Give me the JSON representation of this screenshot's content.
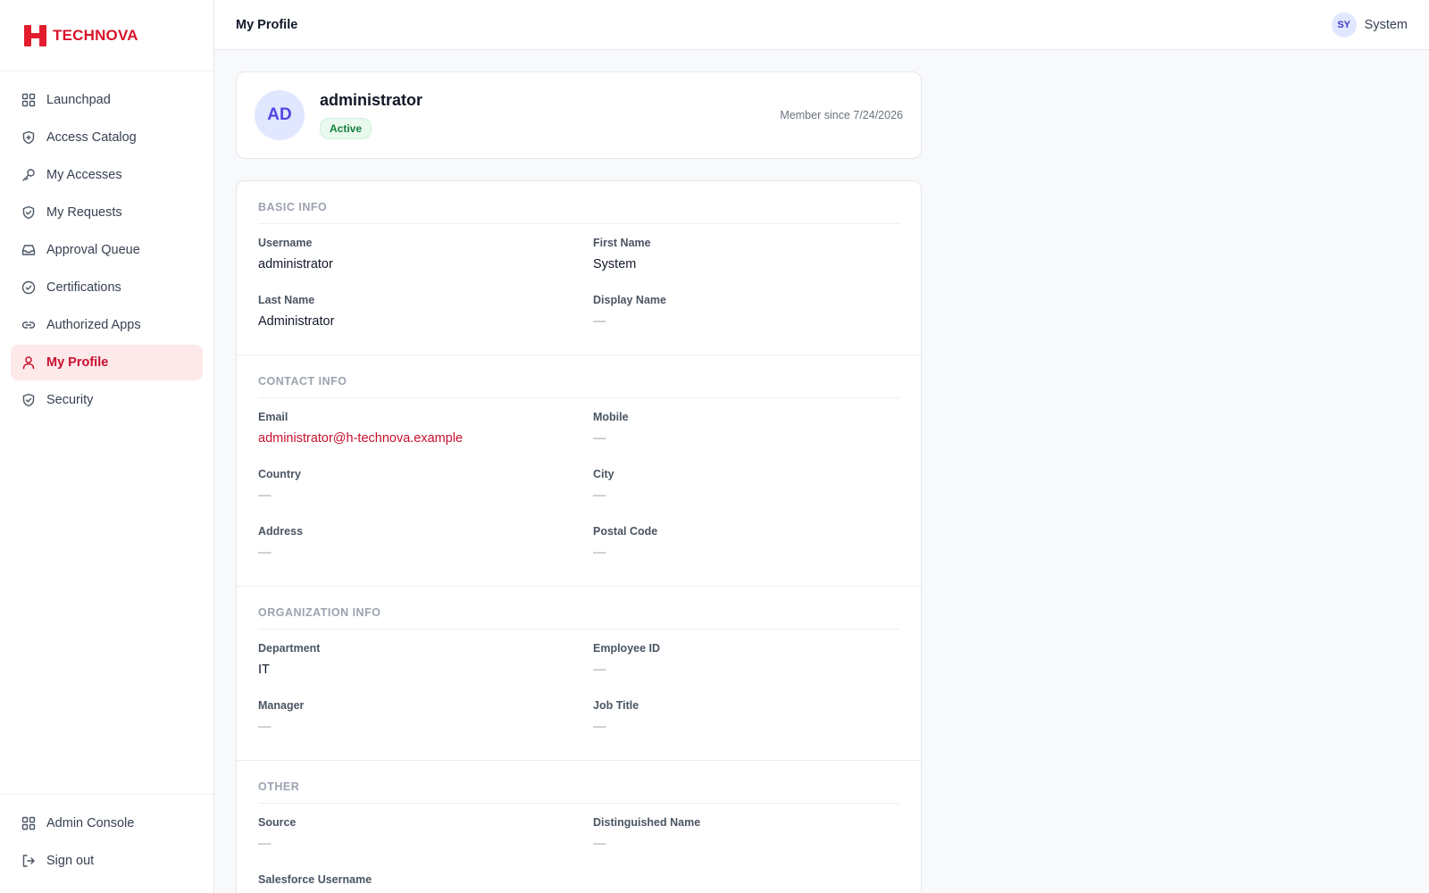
{
  "brand": {
    "name": "TECHNOVA",
    "accent": "#d9142b"
  },
  "sidebar": {
    "items": [
      {
        "label": "Launchpad",
        "icon": "grid-icon"
      },
      {
        "label": "Access Catalog",
        "icon": "shield-plus-icon"
      },
      {
        "label": "My Accesses",
        "icon": "key-icon"
      },
      {
        "label": "My Requests",
        "icon": "shield-check-icon"
      },
      {
        "label": "Approval Queue",
        "icon": "inbox-icon"
      },
      {
        "label": "Certifications",
        "icon": "check-circle-icon"
      },
      {
        "label": "Authorized Apps",
        "icon": "link-icon"
      },
      {
        "label": "My Profile",
        "icon": "user-icon",
        "active": true
      },
      {
        "label": "Security",
        "icon": "shield-icon"
      }
    ],
    "bottom": [
      {
        "label": "Admin Console",
        "icon": "grid-icon"
      },
      {
        "label": "Sign out",
        "icon": "sign-out-icon"
      }
    ]
  },
  "header": {
    "title": "My Profile",
    "user_initials": "SY",
    "user_name": "System"
  },
  "profile": {
    "initials": "AD",
    "name": "administrator",
    "status": "Active",
    "member_since": "Member since 7/24/2026"
  },
  "sections": {
    "basic": {
      "title": "BASIC INFO",
      "fields": [
        {
          "label": "Username",
          "value": "administrator"
        },
        {
          "label": "First Name",
          "value": "System"
        },
        {
          "label": "Last Name",
          "value": "Administrator"
        },
        {
          "label": "Display Name",
          "value": "—"
        }
      ]
    },
    "contact": {
      "title": "CONTACT INFO",
      "fields": [
        {
          "label": "Email",
          "value": "administrator@h-technova.example"
        },
        {
          "label": "Mobile",
          "value": "—"
        },
        {
          "label": "Country",
          "value": "—"
        },
        {
          "label": "City",
          "value": "—"
        },
        {
          "label": "Address",
          "value": "—"
        },
        {
          "label": "Postal Code",
          "value": "—"
        }
      ]
    },
    "org": {
      "title": "ORGANIZATION INFO",
      "fields": [
        {
          "label": "Department",
          "value": "IT"
        },
        {
          "label": "Employee ID",
          "value": "—"
        },
        {
          "label": "Manager",
          "value": "—"
        },
        {
          "label": "Job Title",
          "value": "—"
        }
      ]
    },
    "other": {
      "title": "OTHER",
      "fields": [
        {
          "label": "Source",
          "value": "—"
        },
        {
          "label": "Distinguished Name",
          "value": "—"
        },
        {
          "label": "Salesforce Username",
          "value": ""
        }
      ]
    }
  }
}
